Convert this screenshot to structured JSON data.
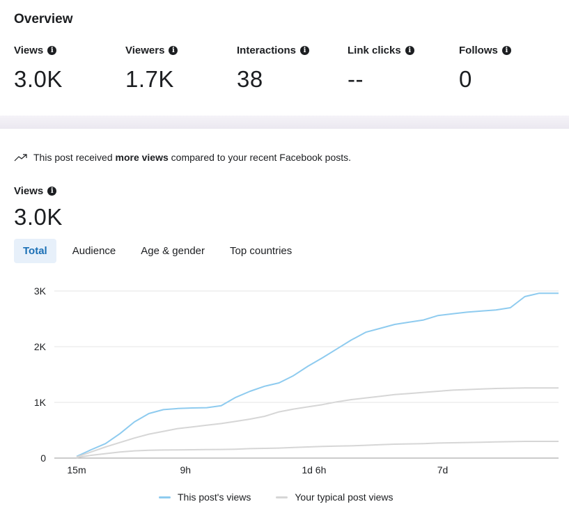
{
  "overview": {
    "title": "Overview",
    "metrics": [
      {
        "label": "Views",
        "value": "3.0K"
      },
      {
        "label": "Viewers",
        "value": "1.7K"
      },
      {
        "label": "Interactions",
        "value": "38"
      },
      {
        "label": "Link clicks",
        "value": "--"
      },
      {
        "label": "Follows",
        "value": "0"
      }
    ]
  },
  "trend": {
    "prefix": "This post received ",
    "bold": "more views",
    "suffix": " compared to your recent Facebook posts."
  },
  "views_section": {
    "label": "Views",
    "value": "3.0K"
  },
  "tabs": [
    {
      "label": "Total",
      "active": true
    },
    {
      "label": "Audience",
      "active": false
    },
    {
      "label": "Age & gender",
      "active": false
    },
    {
      "label": "Top countries",
      "active": false
    }
  ],
  "colors": {
    "this_post": "#8ecbef",
    "typical": "#d6d6d6",
    "grid": "#e4e4e4",
    "active_tab_text": "#1a6fb5"
  },
  "chart_data": {
    "type": "line",
    "x_ticks": [
      "15m",
      "9h",
      "1d 6h",
      "7d"
    ],
    "y_ticks": [
      "0",
      "1K",
      "2K",
      "3K"
    ],
    "ylim": [
      0,
      3000
    ],
    "xlim": [
      0,
      100
    ],
    "x": [
      0,
      3,
      6,
      9,
      12,
      15,
      18,
      21,
      24,
      27,
      30,
      33,
      36,
      39,
      42,
      45,
      48,
      51,
      54,
      57,
      60,
      63,
      66,
      69,
      72,
      75,
      78,
      81,
      84,
      87,
      90,
      93,
      96,
      100
    ],
    "series": [
      {
        "name": "This post's views",
        "values": [
          30,
          150,
          260,
          440,
          650,
          800,
          870,
          890,
          900,
          905,
          940,
          1090,
          1200,
          1290,
          1350,
          1480,
          1650,
          1800,
          1960,
          2120,
          2260,
          2330,
          2400,
          2440,
          2480,
          2560,
          2590,
          2620,
          2640,
          2660,
          2700,
          2900,
          2960,
          2960
        ]
      },
      {
        "name": "Your typical post views",
        "values": [
          20,
          110,
          200,
          280,
          360,
          430,
          480,
          530,
          560,
          590,
          620,
          660,
          700,
          750,
          830,
          880,
          920,
          960,
          1010,
          1050,
          1080,
          1110,
          1140,
          1160,
          1180,
          1200,
          1220,
          1230,
          1240,
          1250,
          1255,
          1260,
          1260,
          1260
        ]
      },
      {
        "name": "",
        "values": [
          10,
          50,
          80,
          110,
          130,
          140,
          145,
          148,
          150,
          152,
          155,
          160,
          170,
          175,
          180,
          190,
          200,
          210,
          215,
          220,
          230,
          240,
          250,
          255,
          260,
          270,
          275,
          280,
          285,
          290,
          295,
          300,
          300,
          300
        ]
      }
    ],
    "legend": [
      "This post's views",
      "Your typical post views"
    ],
    "grid": true
  }
}
